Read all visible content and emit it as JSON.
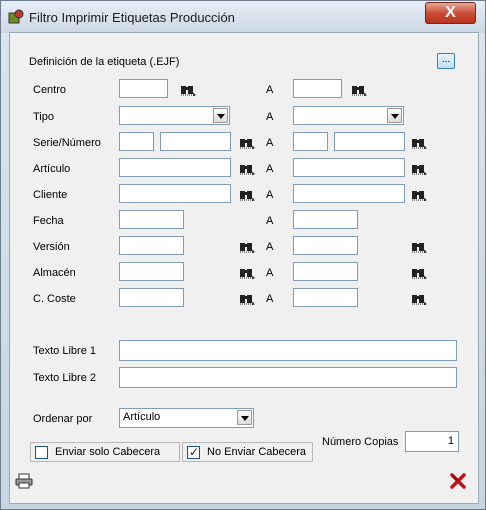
{
  "window": {
    "title": "Filtro Imprimir Etiquetas Producción",
    "close_label": "X"
  },
  "header": {
    "label": "Definición de la etiqueta (.EJF)",
    "browse_label": "..."
  },
  "range_separator": "A",
  "fields": {
    "centro": "Centro",
    "tipo": "Tipo",
    "serie": "Serie/Número",
    "articulo": "Artículo",
    "cliente": "Cliente",
    "fecha": "Fecha",
    "version": "Versión",
    "almacen": "Almacén",
    "coste": "C. Coste",
    "texto1": "Texto Libre 1",
    "texto2": "Texto Libre 2"
  },
  "ordenar": {
    "label": "Ordenar por",
    "value": "Artículo"
  },
  "checkboxes": {
    "solo_cabecera": {
      "label": "Enviar solo Cabecera",
      "checked": false
    },
    "no_cabecera": {
      "label": "No Enviar Cabecera",
      "checked": true
    }
  },
  "copias": {
    "label": "Número Copias",
    "value": "1"
  },
  "icons": {
    "print": "printer-icon",
    "cancel": "red-x-icon",
    "search": "binoculars-icon"
  }
}
